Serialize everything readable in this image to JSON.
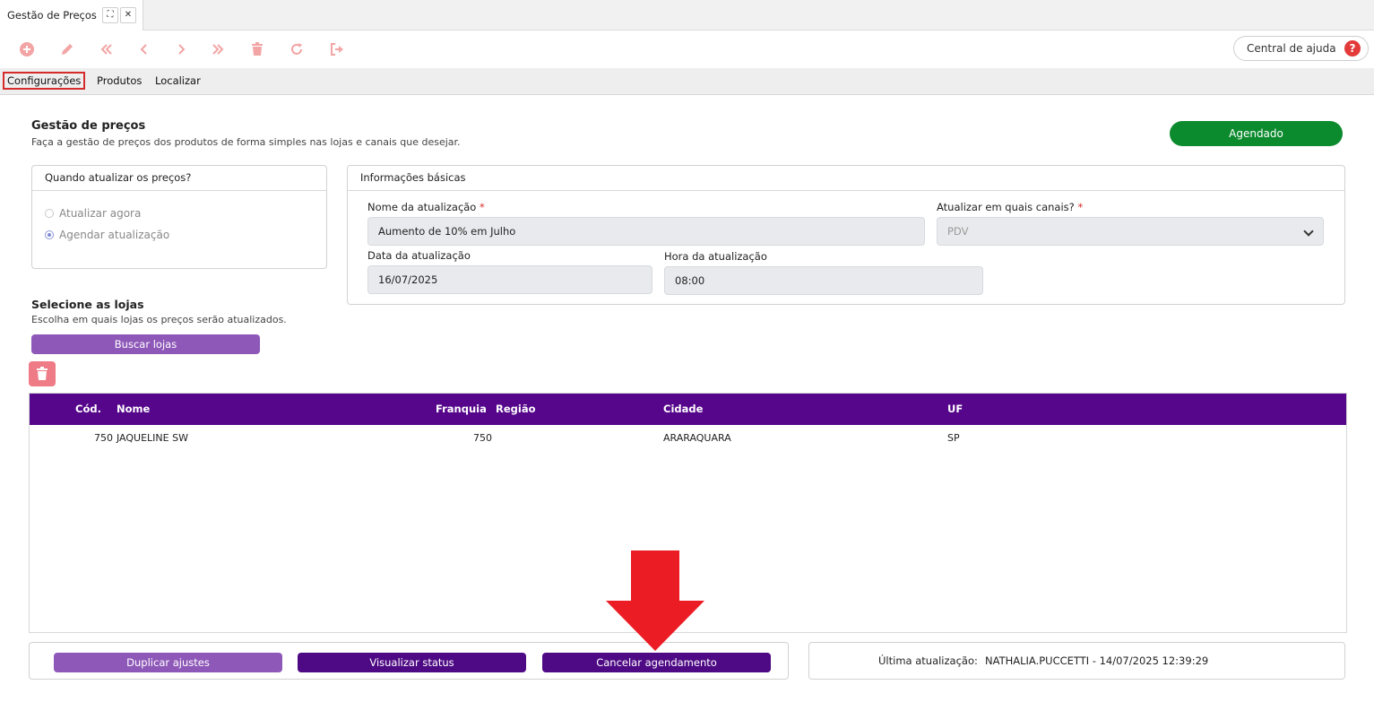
{
  "tab": {
    "title": "Gestão de Preços",
    "expand_glyph": "⛶",
    "close_glyph": "✕"
  },
  "toolbar": {
    "icons": [
      "add-icon",
      "edit-icon",
      "first-icon",
      "previous-icon",
      "next-icon",
      "last-icon",
      "delete-icon",
      "refresh-icon",
      "exit-icon"
    ],
    "icon_color": "#f3a4a4",
    "help_label": "Central de ajuda",
    "help_glyph": "?"
  },
  "subtabs": [
    "Configurações",
    "Produtos",
    "Localizar"
  ],
  "header": {
    "title": "Gestão de preços",
    "subtitle": "Faça a gestão de preços dos produtos de forma simples nas lojas e canais que desejar.",
    "status": "Agendado",
    "status_color": "#0b8a2e"
  },
  "when_panel": {
    "title": "Quando atualizar os preços?",
    "options": [
      "Atualizar agora",
      "Agendar atualização"
    ],
    "selected": "Agendar atualização"
  },
  "basic_info": {
    "title": "Informações básicas",
    "name_label": "Nome da atualização",
    "name_value": "Aumento de 10% em Julho",
    "channels_label": "Atualizar em quais canais?",
    "channels_value": "PDV",
    "date_label": "Data da atualização",
    "date_value": "16/07/2025",
    "time_label": "Hora da atualização",
    "time_value": "08:00",
    "required_mark": "*"
  },
  "stores": {
    "title": "Selecione as lojas",
    "subtitle": "Escolha em quais lojas os preços serão atualizados.",
    "search_button": "Buscar lojas",
    "columns": [
      "Cód.",
      "Nome",
      "Franquia",
      "Região",
      "Cidade",
      "UF"
    ],
    "rows": [
      {
        "cod": "750",
        "nome": "JAQUELINE SW",
        "franquia": "750",
        "regiao": "",
        "cidade": "ARARAQUARA",
        "uf": "SP"
      }
    ]
  },
  "footer": {
    "duplicate": "Duplicar ajustes",
    "view_status": "Visualizar status",
    "cancel": "Cancelar agendamento",
    "last_update_label": "Última atualização:",
    "last_update_value": "NATHALIA.PUCCETTI - 14/07/2025 12:39:29"
  },
  "colors": {
    "purple_dark": "#4e0a85",
    "purple_light": "#8e58b8",
    "grid_header": "#55068b",
    "annotation_red": "#ec1c24"
  }
}
